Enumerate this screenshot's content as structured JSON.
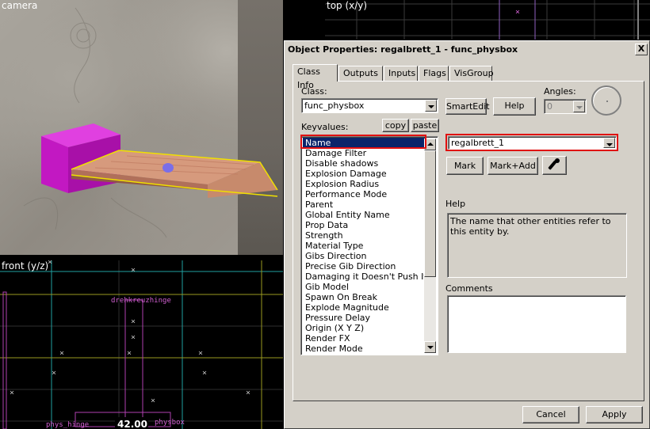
{
  "viewports": {
    "camera": {
      "label": "camera"
    },
    "top": {
      "label": "top (x/y)"
    },
    "front": {
      "label": "front (y/z)",
      "entity_labels": [
        "drehkreuzhinge",
        "phys_hinge",
        "physbox"
      ],
      "measure_label": "42.00"
    }
  },
  "dialog": {
    "title": "Object Properties: regalbrett_1 - func_physbox",
    "close_label": "X",
    "tabs": [
      {
        "label": "Class Info",
        "active": true
      },
      {
        "label": "Outputs"
      },
      {
        "label": "Inputs"
      },
      {
        "label": "Flags"
      },
      {
        "label": "VisGroup"
      }
    ],
    "class": {
      "label": "Class:",
      "value": "func_physbox",
      "smartedit_label": "SmartEdit",
      "help_label": "Help"
    },
    "angles": {
      "label": "Angles:",
      "value": "0"
    },
    "keyvalues": {
      "label": "Keyvalues:",
      "copy_label": "copy",
      "paste_label": "paste",
      "items": [
        "Name",
        "Damage Filter",
        "Disable shadows",
        "Explosion Damage",
        "Explosion Radius",
        "Performance Mode",
        "Parent",
        "Global Entity Name",
        "Prop Data",
        "Strength",
        "Material Type",
        "Gibs Direction",
        "Precise Gib Direction",
        "Damaging it Doesn't Push It",
        "Gib Model",
        "Spawn On Break",
        "Explode Magnitude",
        "Pressure Delay",
        "Origin (X Y Z)",
        "Render FX",
        "Render Mode"
      ],
      "selected_index": 0
    },
    "value_field": {
      "value": "regalbrett_1"
    },
    "mark_label": "Mark",
    "mark_add_label": "Mark+Add",
    "help_section": {
      "label": "Help",
      "text": "The name that other entities refer to this entity by."
    },
    "comments": {
      "label": "Comments",
      "text": ""
    },
    "cancel_label": "Cancel",
    "apply_label": "Apply"
  },
  "colors": {
    "highlight": "#e01010",
    "selection": "#0a246a",
    "entity_box": "#d020d0",
    "plank": "#c98a6e",
    "grid_label": "#d060d0"
  }
}
